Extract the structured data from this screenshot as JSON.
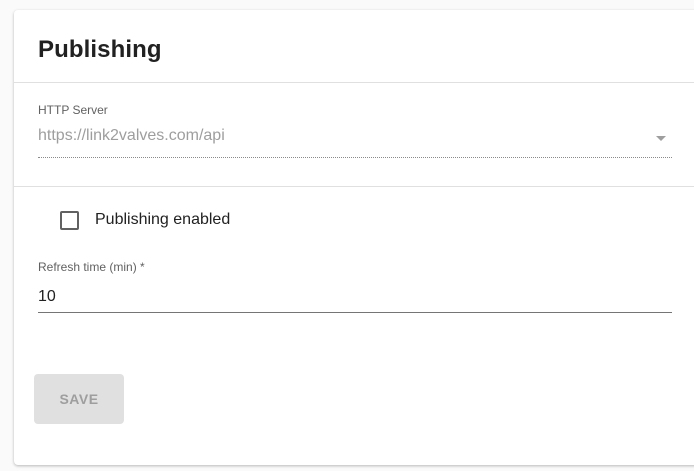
{
  "card": {
    "title": "Publishing"
  },
  "http_server": {
    "label": "HTTP Server",
    "value": "https://link2valves.com/api",
    "icon": "chevron-down-icon"
  },
  "publishing_enabled": {
    "label": "Publishing enabled",
    "checked": false
  },
  "refresh_time": {
    "label": "Refresh time (min) *",
    "value": "10"
  },
  "save_button": {
    "label": "SAVE",
    "disabled": true
  },
  "colors": {
    "card_background": "#ffffff",
    "page_background": "#fafafa",
    "title_text": "#212121",
    "muted_text": "#9e9e9e",
    "divider": "#e0e0e0",
    "disabled_button_bg": "#e0e0e0"
  }
}
